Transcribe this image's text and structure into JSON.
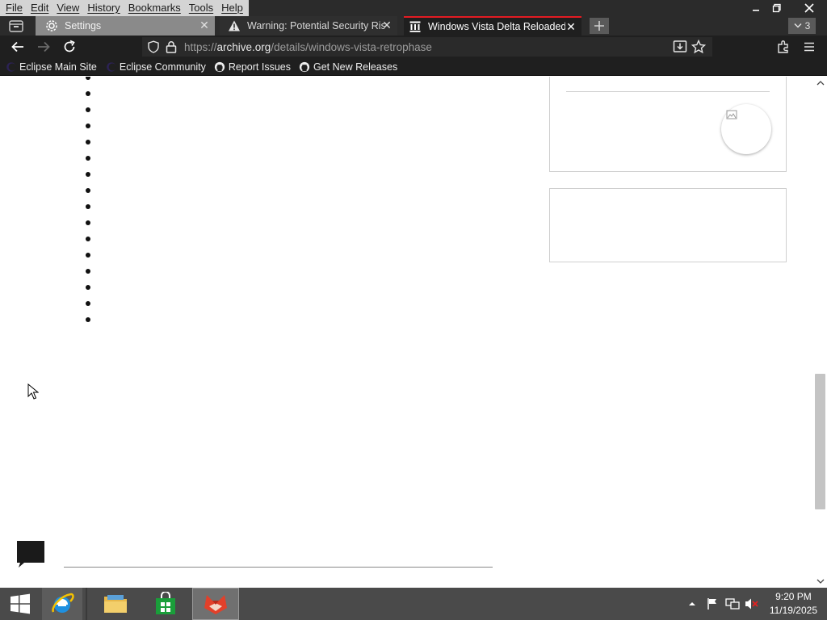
{
  "menubar": {
    "items": [
      {
        "label": "File"
      },
      {
        "label": "Edit"
      },
      {
        "label": "View"
      },
      {
        "label": "History"
      },
      {
        "label": "Bookmarks"
      },
      {
        "label": "Tools"
      },
      {
        "label": "Help"
      }
    ]
  },
  "tabs": [
    {
      "label": "Settings",
      "icon": "gear-icon"
    },
    {
      "label": "Warning: Potential Security Risk",
      "icon": "warning-icon"
    },
    {
      "label": "Windows Vista Delta Reloaded :",
      "icon": "archive-icon",
      "active": true
    }
  ],
  "tab_overflow_count": "3",
  "url": {
    "prefix": "https://",
    "host": "archive.org",
    "path": "/details/windows-vista-retrophase"
  },
  "bookmarks": [
    {
      "label": "Eclipse Main Site",
      "icon": "eclipse-icon"
    },
    {
      "label": "Eclipse Community",
      "icon": "eclipse-icon"
    },
    {
      "label": "Report Issues",
      "icon": "github-icon"
    },
    {
      "label": "Get New Releases",
      "icon": "github-icon"
    }
  ],
  "clock": {
    "time": "9:20 PM",
    "date": "11/19/2025"
  },
  "colors": {
    "active_tab_accent": "#e31b23",
    "chrome_dark": "#1f1f1f",
    "taskbar": "#4a4a4a"
  }
}
